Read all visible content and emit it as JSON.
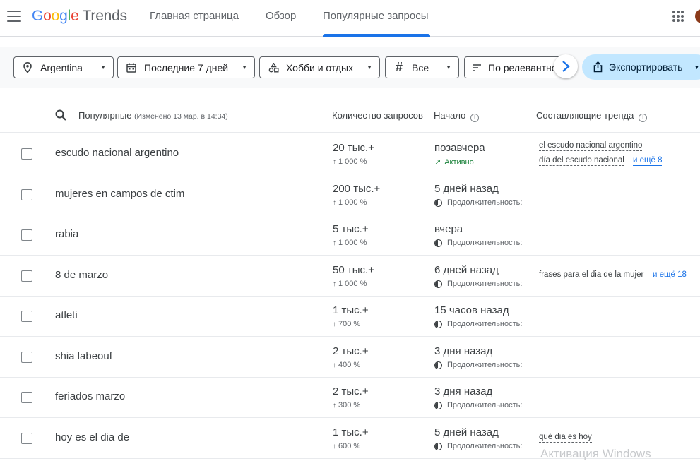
{
  "header": {
    "logo_google": "Google",
    "logo_trends": "Trends",
    "tabs": [
      {
        "label": "Главная страница",
        "active": false
      },
      {
        "label": "Обзор",
        "active": false
      },
      {
        "label": "Популярные запросы",
        "active": true
      }
    ]
  },
  "filters": {
    "location": "Argentina",
    "period": "Последние 7 дней",
    "category": "Хобби и отдых",
    "trend_type": "Все",
    "sort": "По релевантности",
    "export_label": "Экспортировать"
  },
  "table": {
    "headers": {
      "trends": "Популярные",
      "updated": "(Изменено 13 мар. в 14:34)",
      "volume": "Количество запросов",
      "started": "Начало",
      "breakdown": "Составляющие тренда"
    },
    "duration_label": "Продолжительность: ",
    "rows": [
      {
        "term": "escudo nacional argentino",
        "volume": "20 тыс.+",
        "change": "1 000 %",
        "started": "позавчера",
        "status": "Активно",
        "active": true,
        "breakdown": [
          "el escudo nacional argentino",
          "día del escudo nacional"
        ],
        "more": "и ещё 8"
      },
      {
        "term": "mujeres en campos de ctim",
        "volume": "200 тыс.+",
        "change": "1 000 %",
        "started": "5 дней назад",
        "status": "Продолжительность: ",
        "active": false,
        "breakdown": [],
        "more": ""
      },
      {
        "term": "rabia",
        "volume": "5 тыс.+",
        "change": "1 000 %",
        "started": "вчера",
        "status": "Продолжительность: ",
        "active": false,
        "breakdown": [],
        "more": ""
      },
      {
        "term": "8 de marzo",
        "volume": "50 тыс.+",
        "change": "1 000 %",
        "started": "6 дней назад",
        "status": "Продолжительность: ",
        "active": false,
        "breakdown": [
          "frases para el dia de la mujer"
        ],
        "more": "и ещё 18"
      },
      {
        "term": "atleti",
        "volume": "1 тыс.+",
        "change": "700 %",
        "started": "15 часов назад",
        "status": "Продолжительность: ",
        "active": false,
        "breakdown": [],
        "more": ""
      },
      {
        "term": "shia labeouf",
        "volume": "2 тыс.+",
        "change": "400 %",
        "started": "3 дня назад",
        "status": "Продолжительность: ",
        "active": false,
        "breakdown": [],
        "more": ""
      },
      {
        "term": "feriados marzo",
        "volume": "2 тыс.+",
        "change": "300 %",
        "started": "3 дня назад",
        "status": "Продолжительность: ",
        "active": false,
        "breakdown": [],
        "more": ""
      },
      {
        "term": "hoy es el dia de",
        "volume": "1 тыс.+",
        "change": "600 %",
        "started": "5 дней назад",
        "status": "Продолжительность: ",
        "active": false,
        "breakdown": [
          "qué dia es hoy"
        ],
        "more": ""
      }
    ]
  },
  "watermark": "Активация Windows"
}
